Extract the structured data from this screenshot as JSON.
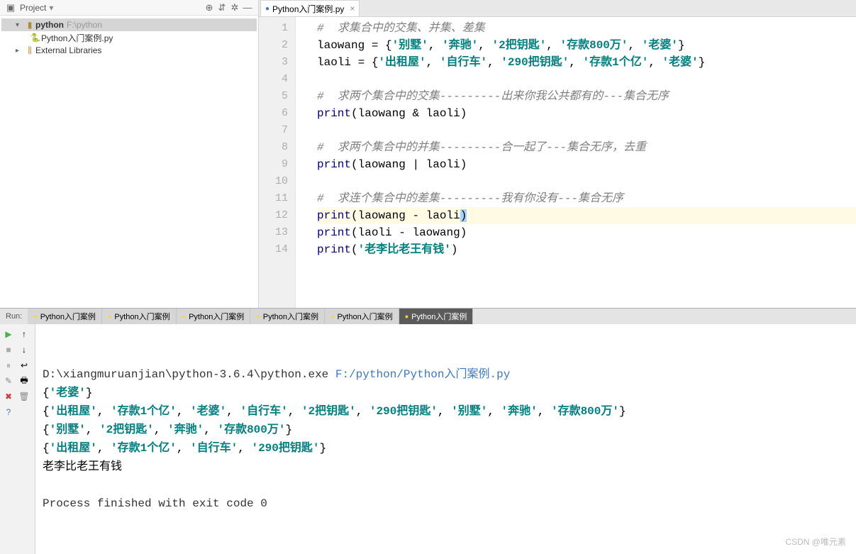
{
  "project": {
    "header_label": "Project",
    "root": {
      "name": "python",
      "path": "F:\\python"
    },
    "file": "Python入门案例.py",
    "external": "External Libraries",
    "toolbar_icons": [
      "target",
      "collapse",
      "gear",
      "hide"
    ]
  },
  "editor": {
    "tab_label": "Python入门案例.py",
    "lines": [
      {
        "n": 1,
        "type": "comment",
        "text": "#  求集合中的交集、并集、差集"
      },
      {
        "n": 2,
        "type": "assign",
        "ident": "laowang",
        "strings": [
          "'别墅'",
          "'奔驰'",
          "'2把钥匙'",
          "'存款800万'",
          "'老婆'"
        ]
      },
      {
        "n": 3,
        "type": "assign",
        "ident": "laoli",
        "strings": [
          "'出租屋'",
          "'自行车'",
          "'290把钥匙'",
          "'存款1个亿'",
          "'老婆'"
        ]
      },
      {
        "n": 4,
        "type": "blank"
      },
      {
        "n": 5,
        "type": "comment",
        "text": "#  求两个集合中的交集---------出来你我公共都有的---集合无序"
      },
      {
        "n": 6,
        "type": "print_op",
        "a": "laowang",
        "op": "&",
        "b": "laoli"
      },
      {
        "n": 7,
        "type": "blank"
      },
      {
        "n": 8,
        "type": "comment",
        "text": "#  求两个集合中的并集---------合一起了---集合无序，去重"
      },
      {
        "n": 9,
        "type": "print_op",
        "a": "laowang",
        "op": "|",
        "b": "laoli"
      },
      {
        "n": 10,
        "type": "blank"
      },
      {
        "n": 11,
        "type": "comment",
        "text": "#  求连个集合中的差集---------我有你没有---集合无序"
      },
      {
        "n": 12,
        "type": "print_op_hl",
        "a": "laowang",
        "op": "-",
        "b": "laoli"
      },
      {
        "n": 13,
        "type": "print_op",
        "a": "laoli",
        "op": "-",
        "b": "laowang"
      },
      {
        "n": 14,
        "type": "print_str",
        "s": "'老李比老王有钱'"
      }
    ]
  },
  "run": {
    "label": "Run:",
    "tabs": [
      "Python入门案例",
      "Python入门案例",
      "Python入门案例",
      "Python入门案例",
      "Python入门案例",
      "Python入门案例"
    ],
    "active_tab": 5,
    "cmd_prefix": "D:\\xiangmuruanjian\\python-3.6.4\\python.exe ",
    "cmd_link": "F:/python/Python入门案例.py",
    "output": [
      "{'老婆'}",
      "{'出租屋', '存款1个亿', '老婆', '自行车', '2把钥匙', '290把钥匙', '别墅', '奔驰', '存款800万'}",
      "{'别墅', '2把钥匙', '奔驰', '存款800万'}",
      "{'出租屋', '存款1个亿', '自行车', '290把钥匙'}",
      "老李比老王有钱"
    ],
    "exit": "Process finished with exit code 0"
  },
  "watermark": "CSDN @唯元素"
}
